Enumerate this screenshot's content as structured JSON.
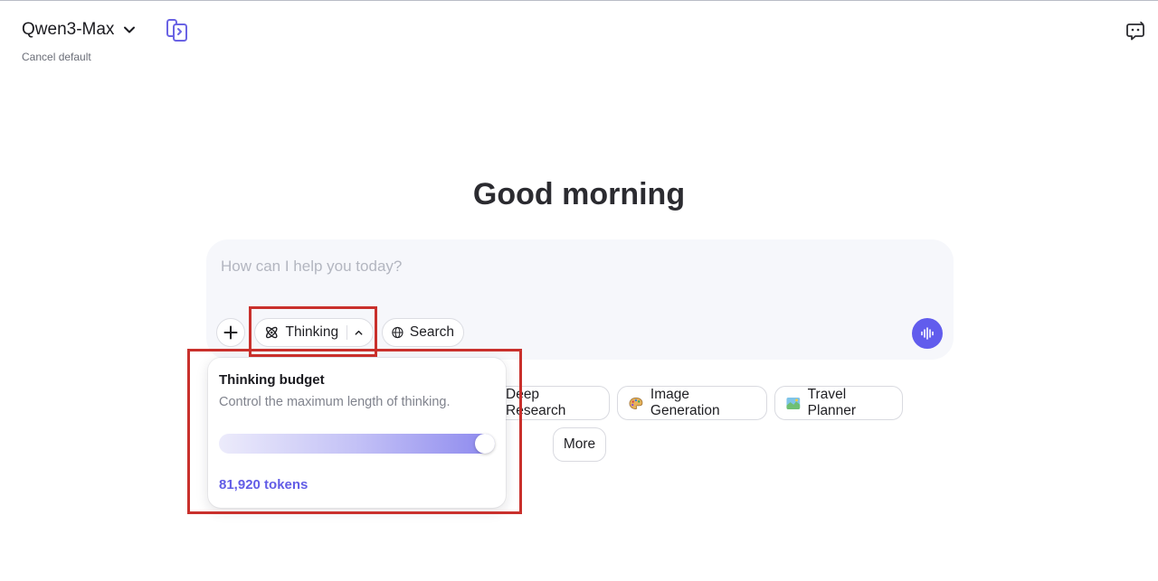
{
  "header": {
    "model_name": "Qwen3-Max",
    "cancel_default": "Cancel default"
  },
  "main": {
    "greeting": "Good morning",
    "composer": {
      "placeholder": "How can I help you today?",
      "thinking_label": "Thinking",
      "search_label": "Search"
    },
    "suggestions": [
      {
        "label": "Deep Research"
      },
      {
        "label": "Image Generation"
      },
      {
        "label": "Travel Planner"
      },
      {
        "label": "More"
      }
    ]
  },
  "popover": {
    "title": "Thinking budget",
    "description": "Control the maximum length of thinking.",
    "tokens_label": "81,920 tokens",
    "slider_value": 1.0
  },
  "colors": {
    "accent": "#615ced",
    "highlight": "#c9302c"
  },
  "icons": [
    "chevron-down-icon",
    "compare-icon",
    "chat-bot-icon",
    "plus-icon",
    "atom-icon",
    "chevron-up-icon",
    "globe-icon",
    "voice-wave-icon",
    "palette-icon",
    "map-icon"
  ]
}
